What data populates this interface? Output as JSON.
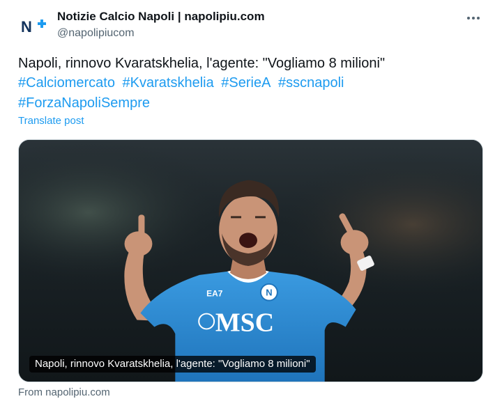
{
  "author": {
    "display_name": "Notizie Calcio Napoli | napolipiu.com",
    "handle": "@napolipiucom",
    "avatar_text": "N+"
  },
  "post": {
    "text": "Napoli, rinnovo Kvaratskhelia, l'agente: \"Vogliamo 8 milioni\"",
    "hashtags": [
      "#Calciomercato",
      "#Kvaratskhelia",
      "#SerieA",
      "#sscnapoli",
      "#ForzaNapoliSempre"
    ],
    "translate_label": "Translate post"
  },
  "card": {
    "caption": "Napoli, rinnovo Kvaratskhelia, l'agente: \"Vogliamo 8 milioni\"",
    "shirt_sponsor": "MSC",
    "shirt_brand": "EA7"
  },
  "footer": {
    "source": "From napolipiu.com"
  },
  "colors": {
    "link": "#1d9bf0",
    "secondary_text": "#536471",
    "shirt": "#2f8fd6",
    "avatar_blue": "#12325c"
  },
  "icons": {
    "more": "more-horizontal-icon"
  }
}
